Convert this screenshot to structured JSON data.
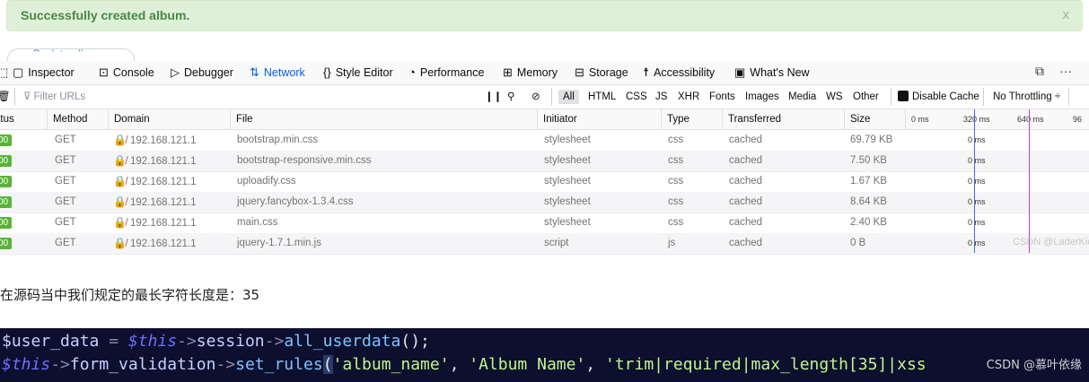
{
  "alert": {
    "message": "Successfully created album.",
    "close": "x"
  },
  "back_button": {
    "label": "Back to album"
  },
  "devtools": {
    "tabs": [
      {
        "icon": "pick-icon",
        "glyph": "⬚",
        "label": ""
      },
      {
        "icon": "inspector-icon",
        "glyph": "▢",
        "label": "Inspector"
      },
      {
        "icon": "console-icon",
        "glyph": "⊡",
        "label": "Console"
      },
      {
        "icon": "debugger-icon",
        "glyph": "▷",
        "label": "Debugger"
      },
      {
        "icon": "network-icon",
        "glyph": "⇅",
        "label": "Network"
      },
      {
        "icon": "style-editor-icon",
        "glyph": "{}",
        "label": "Style Editor"
      },
      {
        "icon": "performance-icon",
        "glyph": "◔",
        "label": "Performance"
      },
      {
        "icon": "memory-icon",
        "glyph": "⊞",
        "label": "Memory"
      },
      {
        "icon": "storage-icon",
        "glyph": "⊟",
        "label": "Storage"
      },
      {
        "icon": "accessibility-icon",
        "glyph": "☨",
        "label": "Accessibility"
      },
      {
        "icon": "whats-new-icon",
        "glyph": "▣",
        "label": "What's New"
      }
    ],
    "active_tab": "Network",
    "overflow_button": "···",
    "filter": {
      "placeholder": "Filter URLs",
      "types": [
        "All",
        "HTML",
        "CSS",
        "JS",
        "XHR",
        "Fonts",
        "Images",
        "Media",
        "WS",
        "Other"
      ],
      "active_type": "All",
      "disable_cache": "Disable Cache",
      "throttling": "No Throttling ÷"
    },
    "columns": [
      "atus",
      "Method",
      "Domain",
      "File",
      "Initiator",
      "Type",
      "Transferred",
      "Size"
    ],
    "waterfall_ticks": [
      "0 ms",
      "320 ms",
      "640 ms",
      "96"
    ],
    "rows": [
      {
        "status": "00",
        "method": "GET",
        "domain": "192.168.121.1",
        "file": "bootstrap.min.css",
        "initiator": "stylesheet",
        "type": "css",
        "transferred": "cached",
        "size": "69.79 KB",
        "timing": "0 ms"
      },
      {
        "status": "00",
        "method": "GET",
        "domain": "192.168.121.1",
        "file": "bootstrap-responsive.min.css",
        "initiator": "stylesheet",
        "type": "css",
        "transferred": "cached",
        "size": "7.50 KB",
        "timing": "0 ms"
      },
      {
        "status": "00",
        "method": "GET",
        "domain": "192.168.121.1",
        "file": "uploadify.css",
        "initiator": "stylesheet",
        "type": "css",
        "transferred": "cached",
        "size": "1.67 KB",
        "timing": "0 ms"
      },
      {
        "status": "00",
        "method": "GET",
        "domain": "192.168.121.1",
        "file": "jquery.fancybox-1.3.4.css",
        "initiator": "stylesheet",
        "type": "css",
        "transferred": "cached",
        "size": "8.64 KB",
        "timing": "0 ms"
      },
      {
        "status": "00",
        "method": "GET",
        "domain": "192.168.121.1",
        "file": "main.css",
        "initiator": "stylesheet",
        "type": "css",
        "transferred": "cached",
        "size": "2.40 KB",
        "timing": "0 ms"
      },
      {
        "status": "00",
        "method": "GET",
        "domain": "192.168.121.1",
        "file": "jquery-1.7.1.min.js",
        "initiator": "script",
        "type": "js",
        "transferred": "cached",
        "size": "0 B",
        "timing": "0 ms"
      }
    ],
    "watermark": "CSDN @LaderKick"
  },
  "caption": "在源码当中我们规定的最长字符长度是：35",
  "code": {
    "line1": {
      "var": "$user_data",
      "eq": " = ",
      "this": "$this",
      "arrow1": "->",
      "prop": "session",
      "arrow2": "->",
      "method": "all_userdata",
      "end": "();"
    },
    "line2": {
      "this": "$this",
      "arrow1": "->",
      "prop": "form_validation",
      "arrow2": "->",
      "method": "set_rules",
      "open": "(",
      "arg1": "'album_name'",
      "comma1": ", ",
      "arg2": "'Album Name'",
      "comma2": ", ",
      "arg3": "'trim|required|max_length[35]",
      "tail": "|xss"
    },
    "watermark": "CSDN @慕叶依缘"
  },
  "colors": {
    "alert_bg": "#dff0d8",
    "alert_text": "#468847",
    "network_active": "#0060df",
    "status_ok": "#58b436",
    "code_bg": "#0c0f2d"
  }
}
